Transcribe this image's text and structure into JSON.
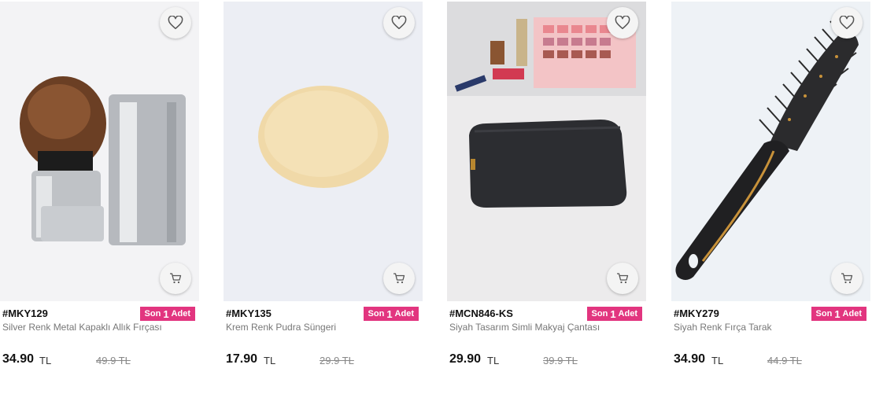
{
  "products": [
    {
      "sku": "#MKY129",
      "badge_prefix": "Son",
      "badge_count": "1",
      "badge_suffix": "Adet",
      "name": "Silver Renk Metal Kapaklı Allık Fırçası",
      "price": "34.90",
      "currency": "TL",
      "old_price": "49.9 TL",
      "image_icon": "kabuki-brush-image",
      "favorite_icon": "heart-icon",
      "cart_icon": "cart-icon"
    },
    {
      "sku": "#MKY135",
      "badge_prefix": "Son",
      "badge_count": "1",
      "badge_suffix": "Adet",
      "name": "Krem Renk Pudra Süngeri",
      "price": "17.90",
      "currency": "TL",
      "old_price": "29.9 TL",
      "image_icon": "powder-sponge-image",
      "favorite_icon": "heart-icon",
      "cart_icon": "cart-icon"
    },
    {
      "sku": "#MCN846-KS",
      "badge_prefix": "Son",
      "badge_count": "1",
      "badge_suffix": "Adet",
      "name": "Siyah Tasarım Simli Makyaj Çantası",
      "price": "29.90",
      "currency": "TL",
      "old_price": "39.9 TL",
      "image_icon": "makeup-bag-image",
      "favorite_icon": "heart-icon",
      "cart_icon": "cart-icon"
    },
    {
      "sku": "#MKY279",
      "badge_prefix": "Son",
      "badge_count": "1",
      "badge_suffix": "Adet",
      "name": "Siyah Renk Fırça Tarak",
      "price": "34.90",
      "currency": "TL",
      "old_price": "44.9 TL",
      "image_icon": "hair-brush-image",
      "favorite_icon": "heart-icon",
      "cart_icon": "cart-icon"
    }
  ],
  "colors": {
    "badge_bg": "#e2357f",
    "badge_text": "#ffffff",
    "price_text": "#111111",
    "name_text": "#777777",
    "old_price_text": "#888888"
  }
}
